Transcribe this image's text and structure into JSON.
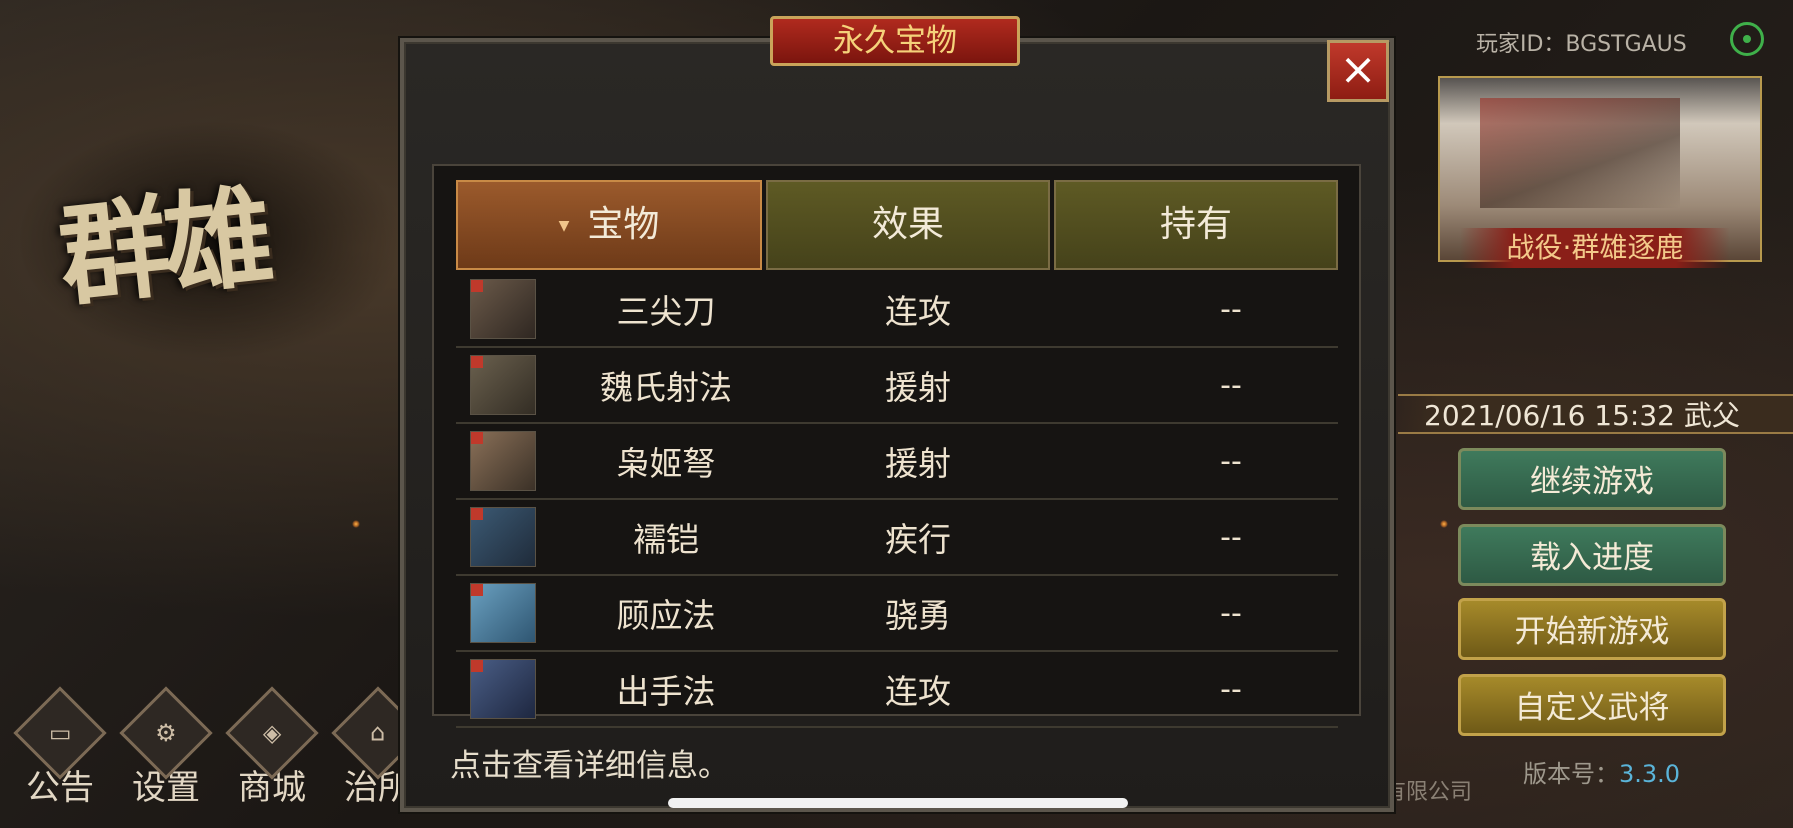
{
  "background": {
    "game_title_partial": "群雄",
    "left_menu": [
      {
        "label": "公告",
        "icon": "announcement-icon",
        "glyph": "▭"
      },
      {
        "label": "设置",
        "icon": "settings-gear-icon",
        "glyph": "⚙"
      },
      {
        "label": "商城",
        "icon": "shop-icon",
        "glyph": "◈"
      },
      {
        "label": "治所",
        "icon": "government-office-icon",
        "glyph": "⌂"
      }
    ],
    "player_id": "玩家ID：BGSTGAUS",
    "campaign_label": "战役·群雄逐鹿",
    "save_info": "2021/06/16 15:32 武父",
    "menu_buttons": [
      {
        "label": "继续游戏",
        "style": "green"
      },
      {
        "label": "载入进度",
        "style": "green"
      },
      {
        "label": "开始新游戏",
        "style": "gold"
      },
      {
        "label": "自定义武将",
        "style": "gold"
      }
    ],
    "version_label": "版本号：",
    "version_number": "3.3.0",
    "company_partial": "有限公司"
  },
  "modal": {
    "title": "永久宝物",
    "close_label": "×",
    "columns": {
      "treasure": "宝物",
      "effect": "效果",
      "held": "持有"
    },
    "rows": [
      {
        "name": "三尖刀",
        "effect": "连攻",
        "held": "--",
        "thumb_color": "#4a3c32"
      },
      {
        "name": "魏氏射法",
        "effect": "援射",
        "held": "--",
        "thumb_color": "#4e4538"
      },
      {
        "name": "枭姬弩",
        "effect": "援射",
        "held": "--",
        "thumb_color": "#5b4c3c"
      },
      {
        "name": "襦铠",
        "effect": "疾行",
        "held": "--",
        "thumb_color": "#2e3a4e"
      },
      {
        "name": "顾应法",
        "effect": "骁勇",
        "held": "--",
        "thumb_color": "#3f6b8a"
      },
      {
        "name": "出手法",
        "effect": "连攻",
        "held": "--",
        "thumb_color": "#2c3a58"
      }
    ],
    "hint": "点击查看详细信息。"
  },
  "colors": {
    "accent_red": "#8e1d13",
    "header_active": "#9b5a2c",
    "header_inactive": "#5e5a24",
    "button_green": "#3f7a5c",
    "button_gold": "#a68a2a"
  }
}
